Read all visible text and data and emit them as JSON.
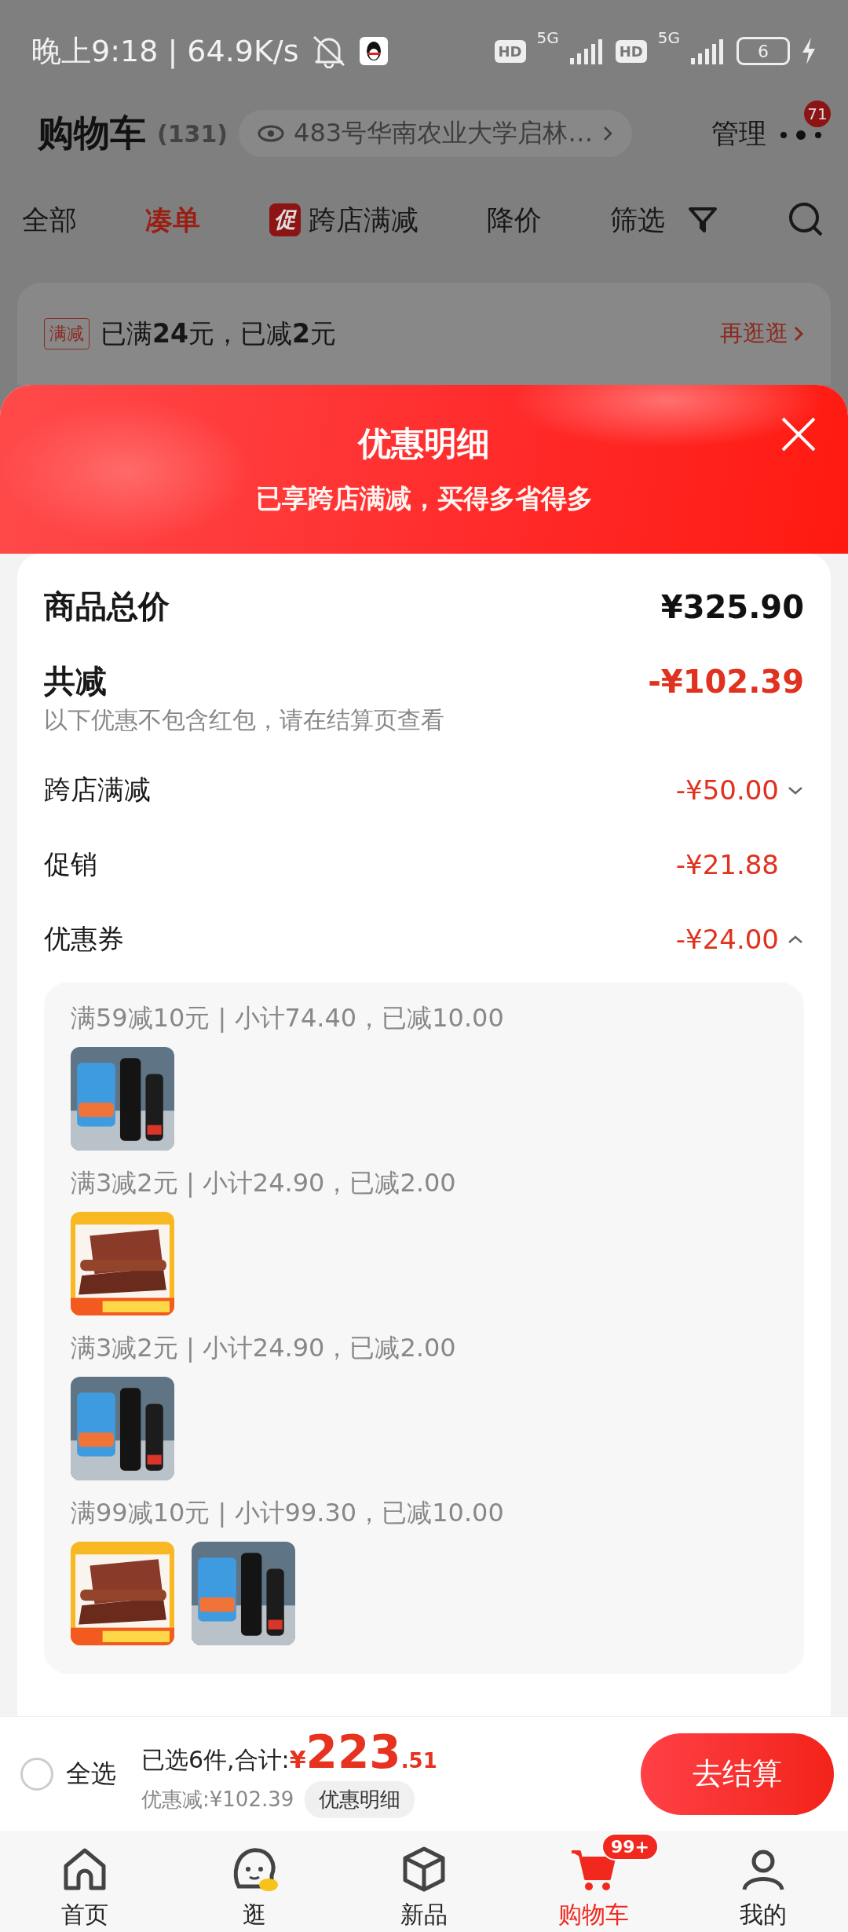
{
  "status_bar": {
    "time": "晚上9:18 | 64.9K/s",
    "sims": [
      {
        "hd": "HD",
        "network": "5G"
      },
      {
        "hd": "HD",
        "network": "5G"
      }
    ],
    "battery": "6"
  },
  "header": {
    "title": "购物车",
    "count": "(131)",
    "address": "483号华南农业大学启林…",
    "manage": "管理",
    "more_badge": "71"
  },
  "tabs": [
    {
      "label": "全部",
      "selected": false
    },
    {
      "label": "凑单",
      "selected": true
    },
    {
      "label": "跨店满减",
      "badge": "促",
      "selected": false
    },
    {
      "label": "降价",
      "selected": false
    },
    {
      "label": "筛选",
      "selected": false
    }
  ],
  "promo_card": {
    "tag": "满减",
    "text": "已满**24**元，已减**2**元",
    "link": "再逛逛"
  },
  "sheet": {
    "title": "优惠明细",
    "subtitle": "已享跨店满减，买得多省得多",
    "rows": [
      {
        "kind": "total",
        "label": "商品总价",
        "value": "¥325.90"
      },
      {
        "kind": "reduction",
        "label": "共减",
        "value": "-¥102.39",
        "note": "以下优惠不包含红包，请在结算页查看"
      },
      {
        "kind": "item",
        "label": "跨店满减",
        "value": "-¥50.00",
        "expanded": false
      },
      {
        "kind": "item",
        "label": "促销",
        "value": "-¥21.88"
      },
      {
        "kind": "item",
        "label": "优惠券",
        "value": "-¥24.00",
        "expanded": true
      }
    ],
    "coupon_groups": [
      {
        "text": "满59减10元 | 小计74.40，已减10.00"
      },
      {
        "text": "满3减2元 | 小计24.90，已减2.00"
      },
      {
        "text": "满3减2元 | 小计24.90，已减2.00"
      },
      {
        "text": "满99减10元 | 小计99.30，已减10.00"
      }
    ]
  },
  "checkout_bar": {
    "select_all": {
      "label": "全选",
      "checked": false
    },
    "summary": "已选6件,合计:",
    "currency": "¥",
    "amount": "223",
    "decimals": ".51",
    "discount": "优惠减:¥102.39",
    "details": "优惠明细",
    "button": "去结算"
  },
  "bottom_nav": [
    {
      "label": "首页",
      "selected": false
    },
    {
      "label": "逛",
      "selected": false
    },
    {
      "label": "新品",
      "selected": false
    },
    {
      "label": "购物车",
      "badge": "99+",
      "selected": true
    },
    {
      "label": "我的",
      "selected": false
    }
  ]
}
